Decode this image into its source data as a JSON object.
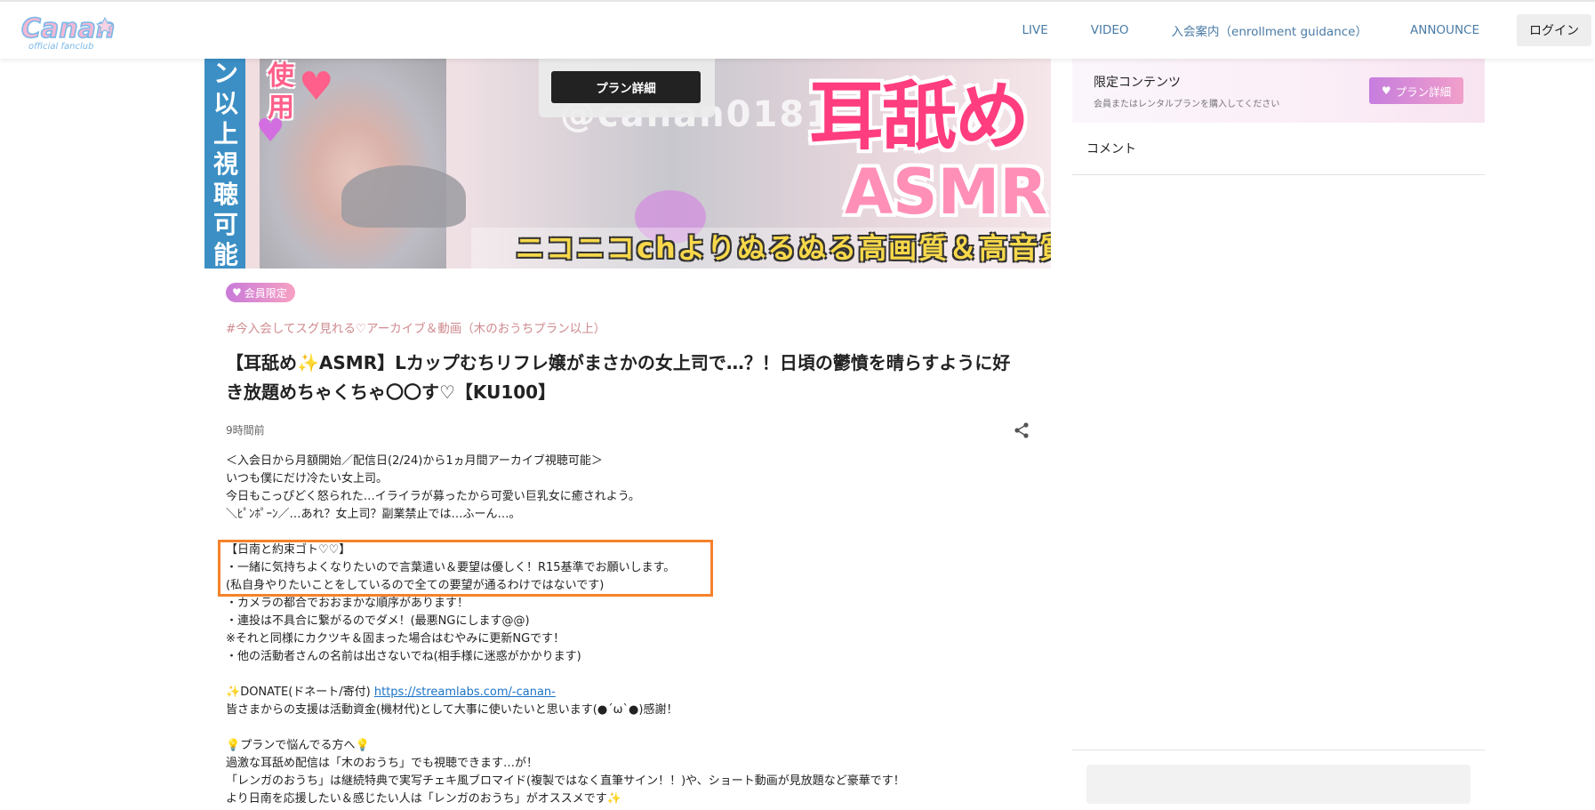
{
  "header": {
    "logo_alt": "Canan official fanclub",
    "logo_line1": "Canan",
    "logo_line2": "official fanclub",
    "nav": [
      "LIVE",
      "VIDEO",
      "入会案内（enrollment guidance）",
      "ANNOUNCE"
    ],
    "login_label": "ログイン"
  },
  "hero": {
    "plan_detail_label": "プラン詳細",
    "strip_text": "ン以上視聴可能",
    "side_text": "使用",
    "watermark": "@canan0181",
    "title_main": "耳舐め",
    "title_sub": "ASMR",
    "footer_text": "ニコニコchよりぬるぬる高画質＆高音質"
  },
  "post": {
    "badge": "会員限定",
    "tag": "#今入会してスグ見れる♡アーカイブ＆動画（木のおうちプラン以上）",
    "title_part1": "【耳舐め",
    "title_part2": "ASMR】Lカップむちリフレ嬢がまさかの女上司で…？！日頃の鬱憤を晴らすように好き放題めちゃくちゃ〇〇す♡【KU100】",
    "time": "9時間前",
    "body": {
      "l1": "＜入会日から月額開始／配信日(2/24)から1ヵ月間アーカイブ視聴可能＞",
      "l2": "いつも僕にだけ冷たい女上司。",
      "l3": "今日もこっぴどく怒られた…イライラが募ったから可愛い巨乳女に癒されよう。",
      "l4": "＼ﾋﾟﾝﾎﾟｰﾝ／…あれ？女上司？副業禁止では…ふーん…。",
      "l5": "【日南と約束ゴト♡♡】",
      "l6": "・一緒に気持ちよくなりたいので言葉遣い＆要望は優しく！R15基準でお願いします。",
      "l7": "(私自身やりたいことをしているので全ての要望が通るわけではないです)",
      "l8": "・カメラの都合でおおまかな順序があります！",
      "l9": "・連投は不具合に繋がるのでダメ！(最悪NGにします@@)",
      "l10": "※それと同様にカクツキ＆固まった場合はむやみに更新NGです！",
      "l11": "・他の活動者さんの名前は出さないでね(相手様に迷惑がかかります)",
      "l12_prefix": "DONATE(ドネート/寄付) ",
      "l12_link": "https://streamlabs.com/-canan-",
      "l13": "皆さまからの支援は活動資金(機材代)として大事に使いたいと思います(●´ω`●)感謝！",
      "l14": "プランで悩んでる方へ",
      "l15": "過激な耳舐め配信は「木のおうち」でも視聴できます…が！",
      "l16": "「レンガのおうち」は継続特典で実写チェキ風ブロマイド(複製ではなく直筆サイン！！)や、ショート動画が見放題など豪華です！",
      "l17": "より日南を応援したい＆感じたい人は「レンガのおうち」がオススメです"
    }
  },
  "sidebar": {
    "title": "限定コンテンツ",
    "subtitle": "会員またはレンタルプランを購入してください",
    "plan_button": "プラン詳細",
    "comment_label": "コメント"
  },
  "colors": {
    "nav_text": "#4a7ba6",
    "accent_pink": "#f19fca",
    "accent_purple": "#c67dde",
    "highlight_orange": "#f5822a",
    "link_blue": "#1a73c8",
    "tag_color": "#cf8a8f"
  }
}
